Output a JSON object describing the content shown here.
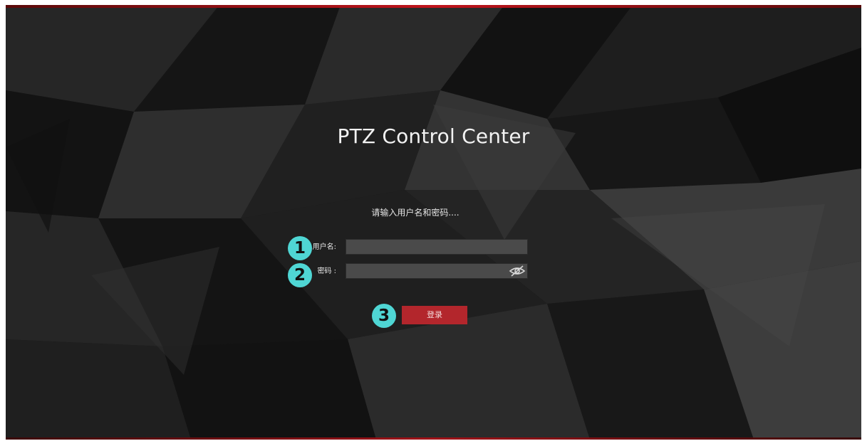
{
  "app": {
    "title": "PTZ Control Center"
  },
  "login": {
    "prompt": "请输入用户名和密码....",
    "username": {
      "label": "用户名:",
      "value": "",
      "placeholder": ""
    },
    "password": {
      "label": "密码 :",
      "value": "",
      "placeholder": "",
      "toggle_icon": "eye-slash-icon"
    },
    "submit_label": "登录"
  },
  "annotations": {
    "badges": [
      "1",
      "2",
      "3"
    ]
  },
  "colors": {
    "accent": "#c0141c",
    "button": "#b3262c",
    "badge": "#4fd6d4",
    "input": "#4a4a4a"
  }
}
